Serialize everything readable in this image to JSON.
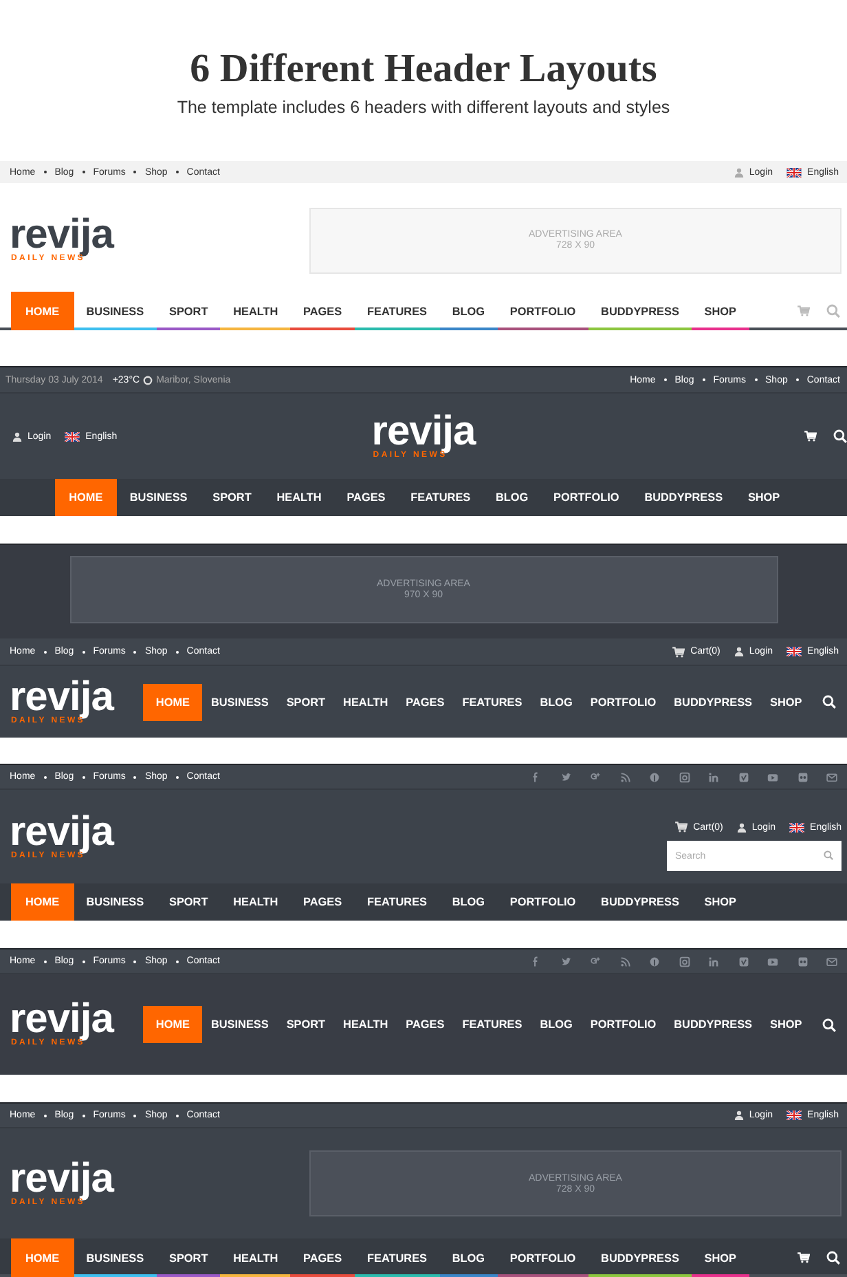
{
  "intro": {
    "title": "6 Different Header Layouts",
    "subtitle": "The template includes 6 headers with different layouts and styles"
  },
  "headers": [
    {
      "kind": "light",
      "rows": [
        {
          "kind": "top",
          "left": [
            {
              "kind": "link",
              "label": "Home"
            },
            {
              "kind": "link",
              "label": "Blog"
            },
            {
              "kind": "link",
              "label": "Forums"
            },
            {
              "kind": "link",
              "label": "Shop"
            },
            {
              "kind": "link",
              "label": "Contact"
            }
          ],
          "right": [
            {
              "kind": "login",
              "label": "Login"
            },
            {
              "kind": "language",
              "label": "English"
            }
          ]
        },
        {
          "kind": "brand",
          "logo": {
            "name": "revija",
            "tagline": "DAILY NEWS"
          },
          "ad": {
            "title": "ADVERTISING AREA",
            "size": "728 X 90"
          }
        },
        {
          "kind": "nav",
          "cart_button": true,
          "search_button": true,
          "items": [
            {
              "label": "HOME",
              "selected": true
            },
            {
              "label": "BUSINESS",
              "selected": false,
              "color": "#3ebfef"
            },
            {
              "label": "SPORT",
              "selected": false,
              "color": "#9a59c6"
            },
            {
              "label": "HEALTH",
              "selected": false,
              "color": "#f5b53f"
            },
            {
              "label": "PAGES",
              "selected": false,
              "color": "#e84c3d"
            },
            {
              "label": "FEATURES",
              "selected": false,
              "color": "#2bbbad"
            },
            {
              "label": "BLOG",
              "selected": false,
              "color": "#3a86c8"
            },
            {
              "label": "PORTFOLIO",
              "selected": false,
              "color": "#a8517c"
            },
            {
              "label": "BUDDYPRESS",
              "selected": false,
              "color": "#8cc63f"
            },
            {
              "label": "SHOP",
              "selected": false,
              "color": "#e8308c"
            }
          ]
        }
      ]
    },
    {
      "kind": "dark",
      "rows": [
        {
          "kind": "top",
          "left": [
            {
              "kind": "date",
              "label": "Thursday 03 July 2014"
            },
            {
              "kind": "weather",
              "label": "+23°C"
            },
            {
              "kind": "location",
              "label": "Maribor, Slovenia"
            }
          ],
          "right": [
            {
              "kind": "link",
              "label": "Home"
            },
            {
              "kind": "link",
              "label": "Blog"
            },
            {
              "kind": "link",
              "label": "Forums"
            },
            {
              "kind": "link",
              "label": "Shop"
            },
            {
              "kind": "link",
              "label": "Contact"
            }
          ]
        },
        {
          "kind": "brand_center",
          "left": [
            {
              "kind": "login",
              "label": "Login"
            },
            {
              "kind": "language",
              "label": "English"
            }
          ],
          "logo": {
            "name": "revija",
            "tagline": "DAILY NEWS"
          },
          "cart_button": true,
          "search_button": true
        },
        {
          "kind": "nav_center",
          "items": [
            {
              "label": "HOME",
              "selected": true
            },
            {
              "label": "BUSINESS",
              "selected": false
            },
            {
              "label": "SPORT",
              "selected": false
            },
            {
              "label": "HEALTH",
              "selected": false
            },
            {
              "label": "PAGES",
              "selected": false
            },
            {
              "label": "FEATURES",
              "selected": false
            },
            {
              "label": "BLOG",
              "selected": false
            },
            {
              "label": "PORTFOLIO",
              "selected": false
            },
            {
              "label": "BUDDYPRESS",
              "selected": false
            },
            {
              "label": "SHOP",
              "selected": false
            }
          ]
        }
      ]
    },
    {
      "kind": "dark",
      "rows": [
        {
          "kind": "ad",
          "ad": {
            "title": "ADVERTISING AREA",
            "size": "970 X 90"
          }
        },
        {
          "kind": "top",
          "left": [
            {
              "kind": "link",
              "label": "Home"
            },
            {
              "kind": "link",
              "label": "Blog"
            },
            {
              "kind": "link",
              "label": "Forums"
            },
            {
              "kind": "link",
              "label": "Shop"
            },
            {
              "kind": "link",
              "label": "Contact"
            }
          ],
          "right": [
            {
              "kind": "cart",
              "label": "Cart(0)"
            },
            {
              "kind": "login",
              "label": "Login"
            },
            {
              "kind": "language",
              "label": "English"
            }
          ]
        },
        {
          "kind": "brand_nav",
          "logo": {
            "name": "revija",
            "tagline": "DAILY NEWS"
          },
          "search_button": true,
          "items": [
            {
              "label": "HOME",
              "selected": true
            },
            {
              "label": "BUSINESS",
              "selected": false
            },
            {
              "label": "SPORT",
              "selected": false
            },
            {
              "label": "HEALTH",
              "selected": false
            },
            {
              "label": "PAGES",
              "selected": false
            },
            {
              "label": "FEATURES",
              "selected": false
            },
            {
              "label": "BLOG",
              "selected": false
            },
            {
              "label": "PORTFOLIO",
              "selected": false
            },
            {
              "label": "BUDDYPRESS",
              "selected": false
            },
            {
              "label": "SHOP",
              "selected": false
            }
          ]
        }
      ]
    },
    {
      "kind": "dark",
      "rows": [
        {
          "kind": "top",
          "left": [
            {
              "kind": "link",
              "label": "Home"
            },
            {
              "kind": "link",
              "label": "Blog"
            },
            {
              "kind": "link",
              "label": "Forums"
            },
            {
              "kind": "link",
              "label": "Shop"
            },
            {
              "kind": "link",
              "label": "Contact"
            }
          ],
          "right": [
            {
              "kind": "social"
            }
          ]
        },
        {
          "kind": "brand",
          "logo": {
            "name": "revija",
            "tagline": "DAILY NEWS"
          },
          "right": [
            {
              "kind": "cart",
              "label": "Cart(0)"
            },
            {
              "kind": "login",
              "label": "Login"
            },
            {
              "kind": "language",
              "label": "English"
            }
          ],
          "search_field": {
            "placeholder": "Search"
          }
        },
        {
          "kind": "nav",
          "items": [
            {
              "label": "HOME",
              "selected": true
            },
            {
              "label": "BUSINESS",
              "selected": false
            },
            {
              "label": "SPORT",
              "selected": false
            },
            {
              "label": "HEALTH",
              "selected": false
            },
            {
              "label": "PAGES",
              "selected": false
            },
            {
              "label": "FEATURES",
              "selected": false
            },
            {
              "label": "BLOG",
              "selected": false
            },
            {
              "label": "PORTFOLIO",
              "selected": false
            },
            {
              "label": "BUDDYPRESS",
              "selected": false
            },
            {
              "label": "SHOP",
              "selected": false
            }
          ]
        }
      ]
    },
    {
      "kind": "dark",
      "rows": [
        {
          "kind": "top",
          "left": [
            {
              "kind": "link",
              "label": "Home"
            },
            {
              "kind": "link",
              "label": "Blog"
            },
            {
              "kind": "link",
              "label": "Forums"
            },
            {
              "kind": "link",
              "label": "Shop"
            },
            {
              "kind": "link",
              "label": "Contact"
            }
          ],
          "right": [
            {
              "kind": "social"
            }
          ]
        },
        {
          "kind": "brand_nav",
          "logo": {
            "name": "revija",
            "tagline": "DAILY NEWS"
          },
          "search_button": true,
          "items": [
            {
              "label": "HOME",
              "selected": true
            },
            {
              "label": "BUSINESS",
              "selected": false
            },
            {
              "label": "SPORT",
              "selected": false
            },
            {
              "label": "HEALTH",
              "selected": false
            },
            {
              "label": "PAGES",
              "selected": false
            },
            {
              "label": "FEATURES",
              "selected": false
            },
            {
              "label": "BLOG",
              "selected": false
            },
            {
              "label": "PORTFOLIO",
              "selected": false
            },
            {
              "label": "BUDDYPRESS",
              "selected": false
            },
            {
              "label": "SHOP",
              "selected": false
            }
          ]
        }
      ]
    },
    {
      "kind": "dark",
      "rows": [
        {
          "kind": "top",
          "left": [
            {
              "kind": "link",
              "label": "Home"
            },
            {
              "kind": "link",
              "label": "Blog"
            },
            {
              "kind": "link",
              "label": "Forums"
            },
            {
              "kind": "link",
              "label": "Shop"
            },
            {
              "kind": "link",
              "label": "Contact"
            }
          ],
          "right": [
            {
              "kind": "login",
              "label": "Login"
            },
            {
              "kind": "language",
              "label": "English"
            }
          ]
        },
        {
          "kind": "brand",
          "logo": {
            "name": "revija",
            "tagline": "DAILY NEWS"
          },
          "ad": {
            "title": "ADVERTISING AREA",
            "size": "728 X 90"
          }
        },
        {
          "kind": "nav",
          "cart_button": true,
          "search_button": true,
          "items": [
            {
              "label": "HOME",
              "selected": true
            },
            {
              "label": "BUSINESS",
              "selected": false,
              "color": "#3ebfef"
            },
            {
              "label": "SPORT",
              "selected": false,
              "color": "#9a59c6"
            },
            {
              "label": "HEALTH",
              "selected": false,
              "color": "#f5b53f"
            },
            {
              "label": "PAGES",
              "selected": false,
              "color": "#e84c3d"
            },
            {
              "label": "FEATURES",
              "selected": false,
              "color": "#2bbbad"
            },
            {
              "label": "BLOG",
              "selected": false,
              "color": "#3a86c8"
            },
            {
              "label": "PORTFOLIO",
              "selected": false,
              "color": "#a8517c"
            },
            {
              "label": "BUDDYPRESS",
              "selected": false,
              "color": "#8cc63f"
            },
            {
              "label": "SHOP",
              "selected": false,
              "color": "#e8308c"
            }
          ]
        }
      ]
    }
  ]
}
